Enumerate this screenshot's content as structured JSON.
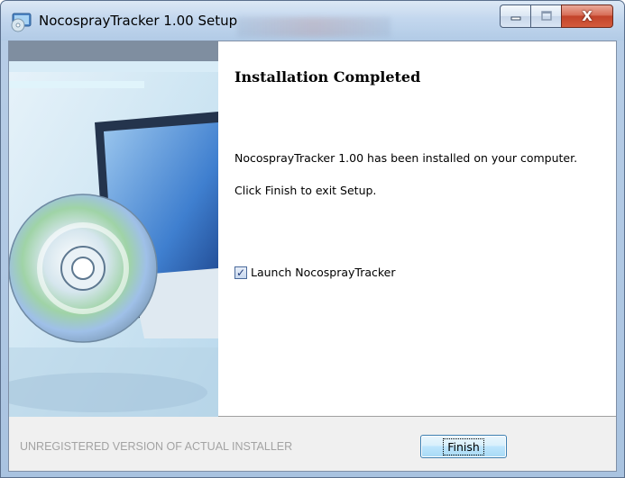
{
  "window": {
    "title": "NocosprayTracker 1.00 Setup",
    "close_glyph": "X"
  },
  "page": {
    "heading": "Installation Completed",
    "message_installed": "NocosprayTracker 1.00 has been installed on your computer.",
    "message_exit": "Click Finish to exit Setup.",
    "launch_checkbox": {
      "label": "Launch NocosprayTracker",
      "checked": true,
      "check_glyph": "✓"
    }
  },
  "footer": {
    "branding": "UNREGISTERED VERSION OF ACTUAL INSTALLER",
    "finish_label": "Finish"
  },
  "icons": {
    "app": "installer-app-icon",
    "minimize": "minimize-icon",
    "maximize": "maximize-icon",
    "close": "close-icon",
    "banner": "cd-disc-monitor-banner"
  },
  "colors": {
    "accent": "#3c7fb1",
    "close_button": "#c2432a",
    "footer_text": "#a3a3a3"
  }
}
